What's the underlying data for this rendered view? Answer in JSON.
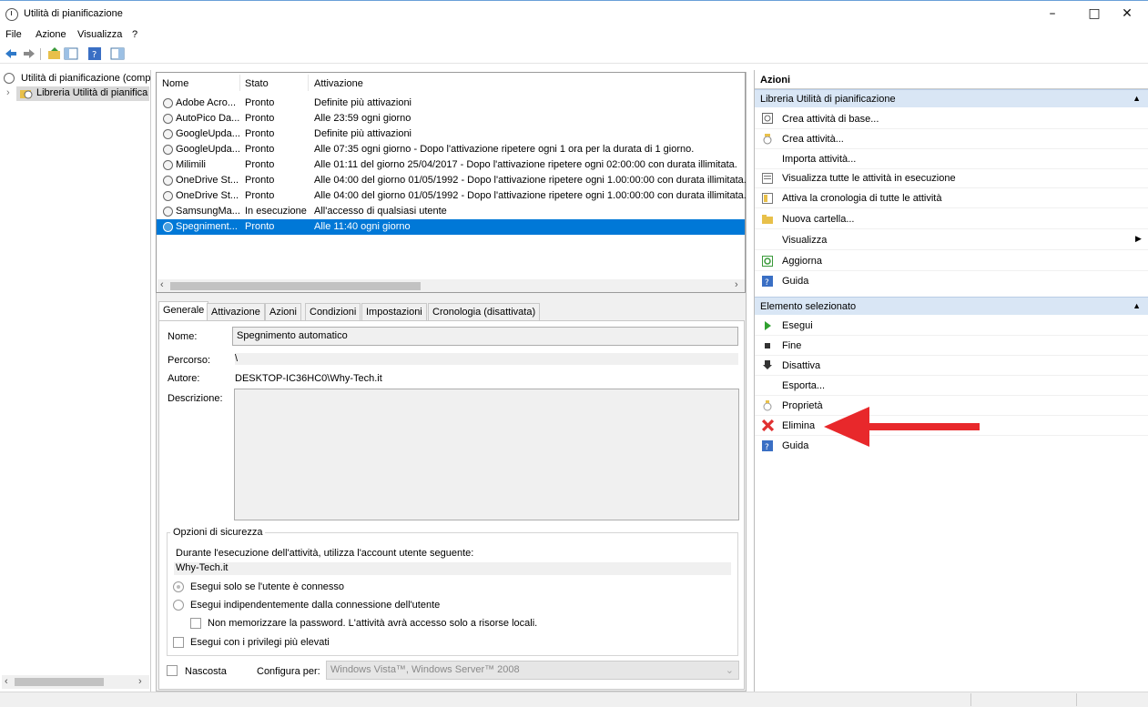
{
  "window": {
    "title": "Utilità di pianificazione",
    "minimize": "–",
    "maximize": "□",
    "close": "✕"
  },
  "menu": [
    "File",
    "Azione",
    "Visualizza",
    "?"
  ],
  "tree": {
    "root": "Utilità di pianificazione (comp",
    "child": "Libreria Utilità di pianifica"
  },
  "tasklist": {
    "headers": [
      "Nome",
      "Stato",
      "Attivazione"
    ],
    "rows": [
      {
        "name": "Adobe Acro...",
        "status": "Pronto",
        "trigger": "Definite più attivazioni"
      },
      {
        "name": "AutoPico Da...",
        "status": "Pronto",
        "trigger": "Alle 23:59 ogni giorno"
      },
      {
        "name": "GoogleUpda...",
        "status": "Pronto",
        "trigger": "Definite più attivazioni"
      },
      {
        "name": "GoogleUpda...",
        "status": "Pronto",
        "trigger": "Alle 07:35 ogni giorno - Dopo l'attivazione ripetere ogni 1 ora per la durata di 1 giorno."
      },
      {
        "name": "Milimili",
        "status": "Pronto",
        "trigger": "Alle 01:11 del giorno 25/04/2017 - Dopo l'attivazione ripetere ogni 02:00:00 con durata illimitata."
      },
      {
        "name": "OneDrive St...",
        "status": "Pronto",
        "trigger": "Alle 04:00 del giorno 01/05/1992 - Dopo l'attivazione ripetere ogni 1.00:00:00 con durata illimitata."
      },
      {
        "name": "OneDrive St...",
        "status": "Pronto",
        "trigger": "Alle 04:00 del giorno 01/05/1992 - Dopo l'attivazione ripetere ogni 1.00:00:00 con durata illimitata."
      },
      {
        "name": "SamsungMa...",
        "status": "In esecuzione",
        "trigger": "All'accesso di qualsiasi utente"
      },
      {
        "name": "Spegniment...",
        "status": "Pronto",
        "trigger": "Alle 11:40 ogni giorno"
      }
    ],
    "selected_index": 8
  },
  "tabs": [
    "Generale",
    "Attivazione",
    "Azioni",
    "Condizioni",
    "Impostazioni",
    "Cronologia (disattivata)"
  ],
  "general": {
    "name_label": "Nome:",
    "name_value": "Spegnimento automatico",
    "path_label": "Percorso:",
    "path_value": "\\",
    "author_label": "Autore:",
    "author_value": "DESKTOP-IC36HC0\\Why-Tech.it",
    "desc_label": "Descrizione:",
    "security_title": "Opzioni di sicurezza",
    "security_text": "Durante l'esecuzione dell'attività, utilizza l'account utente seguente:",
    "account": "Why-Tech.it",
    "radio1": "Esegui solo se l'utente è connesso",
    "radio2": "Esegui indipendentemente dalla connessione dell'utente",
    "check_password": "Non memorizzare la password. L'attività avrà accesso solo a risorse locali.",
    "check_privileges": "Esegui con i privilegi più elevati",
    "hidden_label": "Nascosta",
    "configure_label": "Configura per:",
    "configure_value": "Windows Vista™, Windows Server™ 2008"
  },
  "actions": {
    "title": "Azioni",
    "section1": "Libreria Utilità di pianificazione",
    "items1": [
      "Crea attività di base...",
      "Crea attività...",
      "Importa attività...",
      "Visualizza tutte le attività in esecuzione",
      "Attiva la cronologia di tutte le attività",
      "Nuova cartella...",
      "Visualizza",
      "Aggiorna",
      "Guida"
    ],
    "section2": "Elemento selezionato",
    "items2": [
      "Esegui",
      "Fine",
      "Disattiva",
      "Esporta...",
      "Proprietà",
      "Elimina",
      "Guida"
    ]
  },
  "colors": {
    "selection": "#0078d7",
    "section_header": "#d9e6f5",
    "arrow": "#e8282b",
    "delete_icon": "#e03030"
  },
  "icons": {
    "toolbar": [
      "back-arrow-icon",
      "forward-arrow-icon",
      "up-folder-icon",
      "show-tree-icon",
      "help-icon",
      "show-action-pane-icon"
    ]
  }
}
